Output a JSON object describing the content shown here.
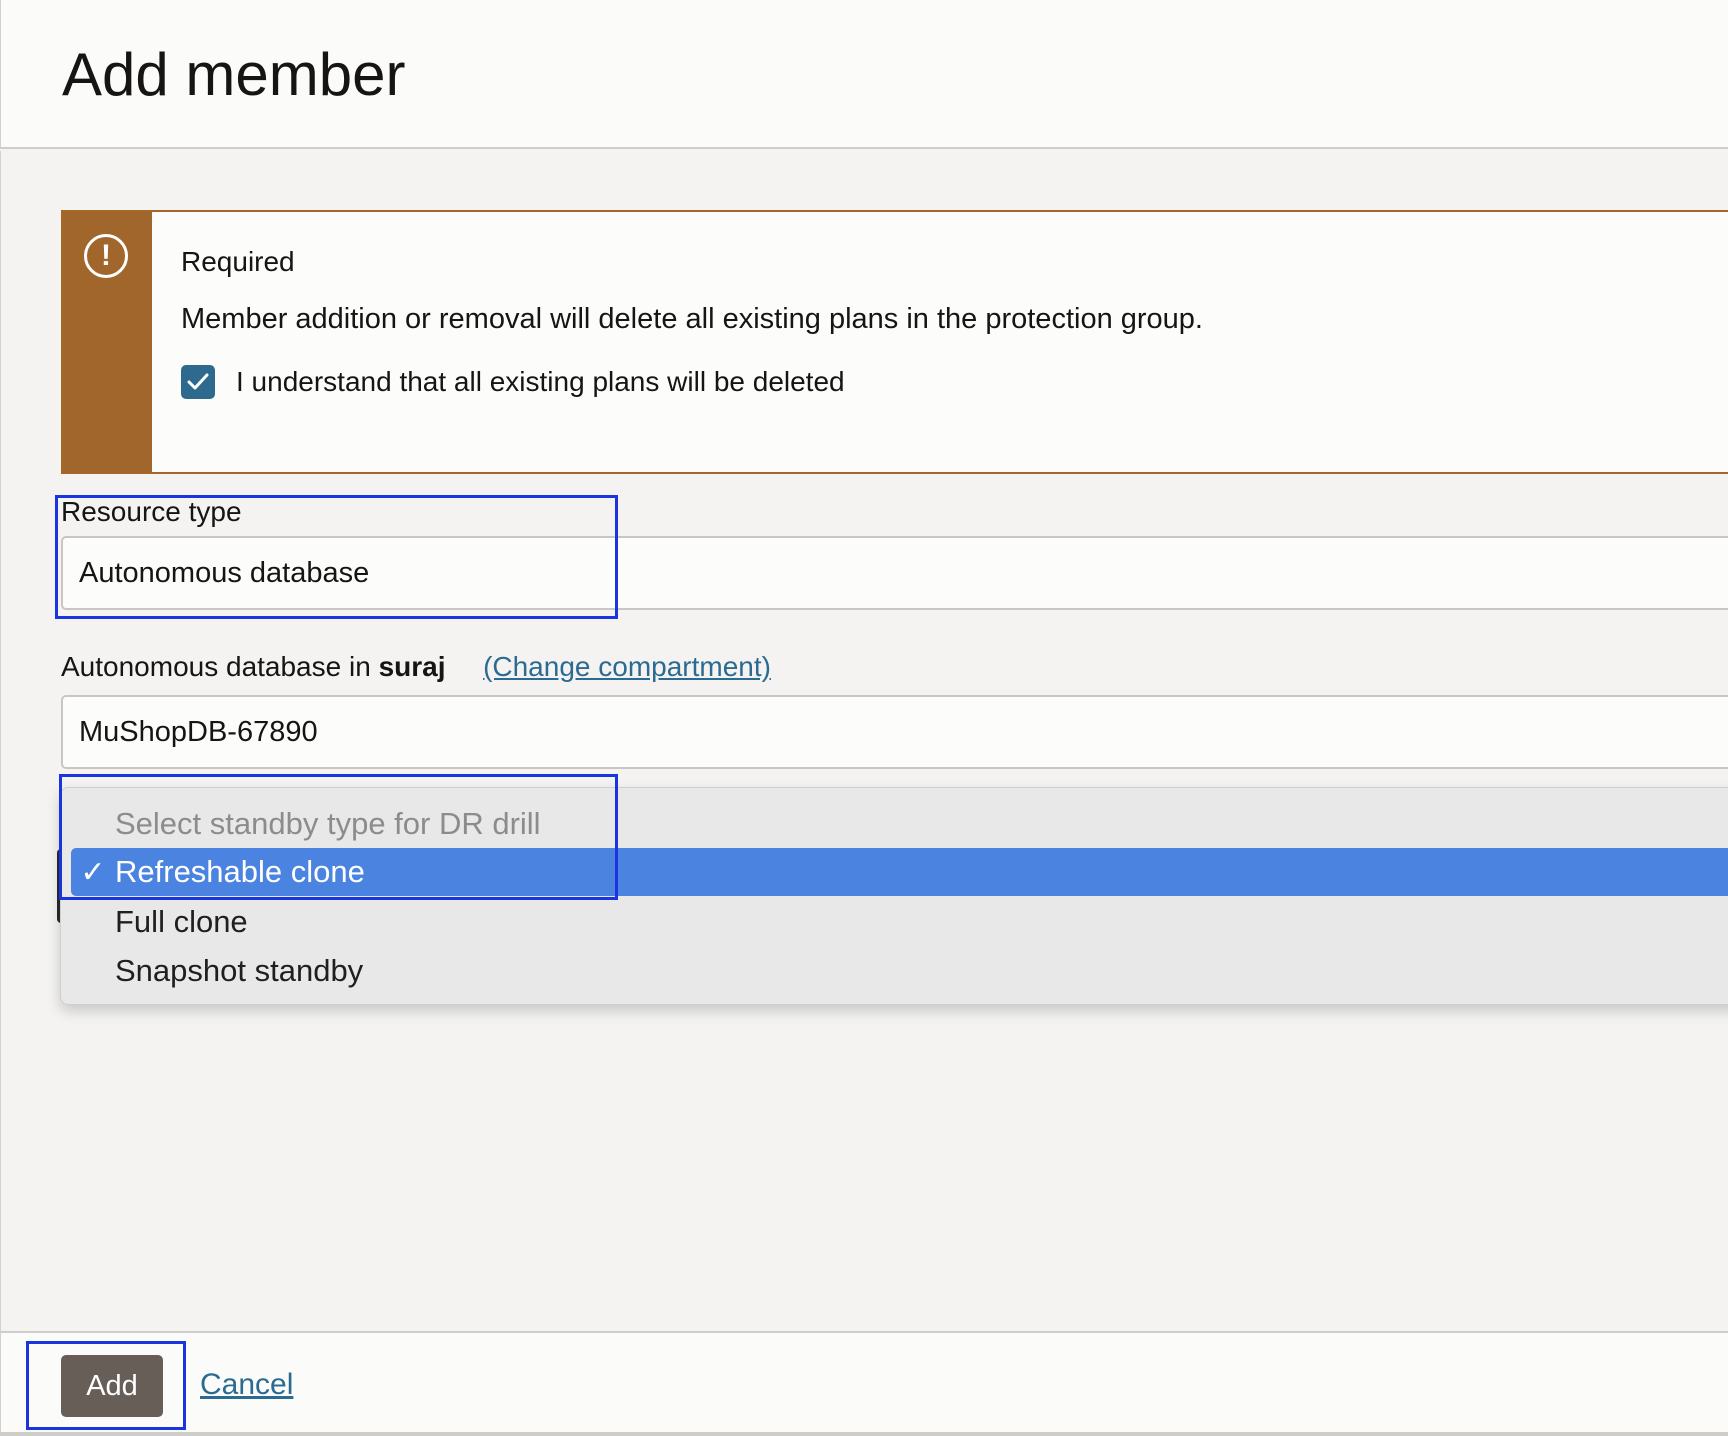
{
  "header": {
    "title": "Add member"
  },
  "alert": {
    "title": "Required",
    "message": "Member addition or removal will delete all existing plans in the protection group.",
    "acknowledgement": {
      "label": "I understand that all existing plans will be deleted",
      "checked": true
    }
  },
  "resource_type": {
    "label": "Resource type",
    "value": "Autonomous database"
  },
  "database": {
    "label_prefix": "Autonomous database in",
    "compartment": "suraj",
    "change_link": "(Change compartment)",
    "value": "MuShopDB-67890"
  },
  "standby_dropdown": {
    "placeholder": "Select standby type for DR drill",
    "options": [
      "Refreshable clone",
      "Full clone",
      "Snapshot standby"
    ],
    "selected": "Refreshable clone",
    "selected_mark": "✓"
  },
  "footer": {
    "add_label": "Add",
    "cancel_label": "Cancel"
  },
  "colors": {
    "alert_accent": "#a1662b",
    "checkbox": "#2e6a8e",
    "selection": "#4a83e0",
    "highlight": "#1a35e0",
    "primary_button": "#665e57",
    "link": "#2c6b91"
  }
}
